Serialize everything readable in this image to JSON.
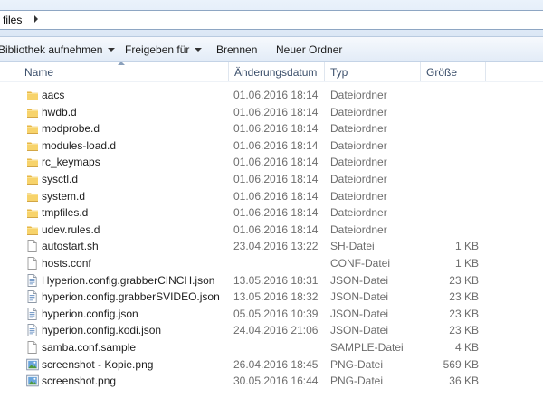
{
  "address": {
    "current_folder": "files"
  },
  "toolbar": {
    "include_library": "Bibliothek aufnehmen",
    "share_with": "Freigeben für",
    "burn": "Brennen",
    "new_folder": "Neuer Ordner"
  },
  "columns": {
    "name": "Name",
    "date": "Änderungsdatum",
    "type": "Typ",
    "size": "Größe"
  },
  "files": [
    {
      "name": "aacs",
      "date": "01.06.2016 18:14",
      "type": "Dateiordner",
      "size": "",
      "icon": "folder-icon"
    },
    {
      "name": "hwdb.d",
      "date": "01.06.2016 18:14",
      "type": "Dateiordner",
      "size": "",
      "icon": "folder-icon"
    },
    {
      "name": "modprobe.d",
      "date": "01.06.2016 18:14",
      "type": "Dateiordner",
      "size": "",
      "icon": "folder-icon"
    },
    {
      "name": "modules-load.d",
      "date": "01.06.2016 18:14",
      "type": "Dateiordner",
      "size": "",
      "icon": "folder-icon"
    },
    {
      "name": "rc_keymaps",
      "date": "01.06.2016 18:14",
      "type": "Dateiordner",
      "size": "",
      "icon": "folder-icon"
    },
    {
      "name": "sysctl.d",
      "date": "01.06.2016 18:14",
      "type": "Dateiordner",
      "size": "",
      "icon": "folder-icon"
    },
    {
      "name": "system.d",
      "date": "01.06.2016 18:14",
      "type": "Dateiordner",
      "size": "",
      "icon": "folder-icon"
    },
    {
      "name": "tmpfiles.d",
      "date": "01.06.2016 18:14",
      "type": "Dateiordner",
      "size": "",
      "icon": "folder-icon"
    },
    {
      "name": "udev.rules.d",
      "date": "01.06.2016 18:14",
      "type": "Dateiordner",
      "size": "",
      "icon": "folder-icon"
    },
    {
      "name": "autostart.sh",
      "date": "23.04.2016 13:22",
      "type": "SH-Datei",
      "size": "1 KB",
      "icon": "blank-file-icon"
    },
    {
      "name": "hosts.conf",
      "date": "",
      "type": "CONF-Datei",
      "size": "1 KB",
      "icon": "blank-file-icon"
    },
    {
      "name": "Hyperion.config.grabberCINCH.json",
      "date": "13.05.2016 18:31",
      "type": "JSON-Datei",
      "size": "23 KB",
      "icon": "text-file-icon"
    },
    {
      "name": "hyperion.config.grabberSVIDEO.json",
      "date": "13.05.2016 18:32",
      "type": "JSON-Datei",
      "size": "23 KB",
      "icon": "text-file-icon"
    },
    {
      "name": "hyperion.config.json",
      "date": "05.05.2016 10:39",
      "type": "JSON-Datei",
      "size": "23 KB",
      "icon": "text-file-icon"
    },
    {
      "name": "hyperion.config.kodi.json",
      "date": "24.04.2016 21:06",
      "type": "JSON-Datei",
      "size": "23 KB",
      "icon": "text-file-icon"
    },
    {
      "name": "samba.conf.sample",
      "date": "",
      "type": "SAMPLE-Datei",
      "size": "4 KB",
      "icon": "blank-file-icon"
    },
    {
      "name": "screenshot - Kopie.png",
      "date": "26.04.2016 18:45",
      "type": "PNG-Datei",
      "size": "569 KB",
      "icon": "image-file-icon"
    },
    {
      "name": "screenshot.png",
      "date": "30.05.2016 16:44",
      "type": "PNG-Datei",
      "size": "36 KB",
      "icon": "image-file-icon"
    }
  ]
}
